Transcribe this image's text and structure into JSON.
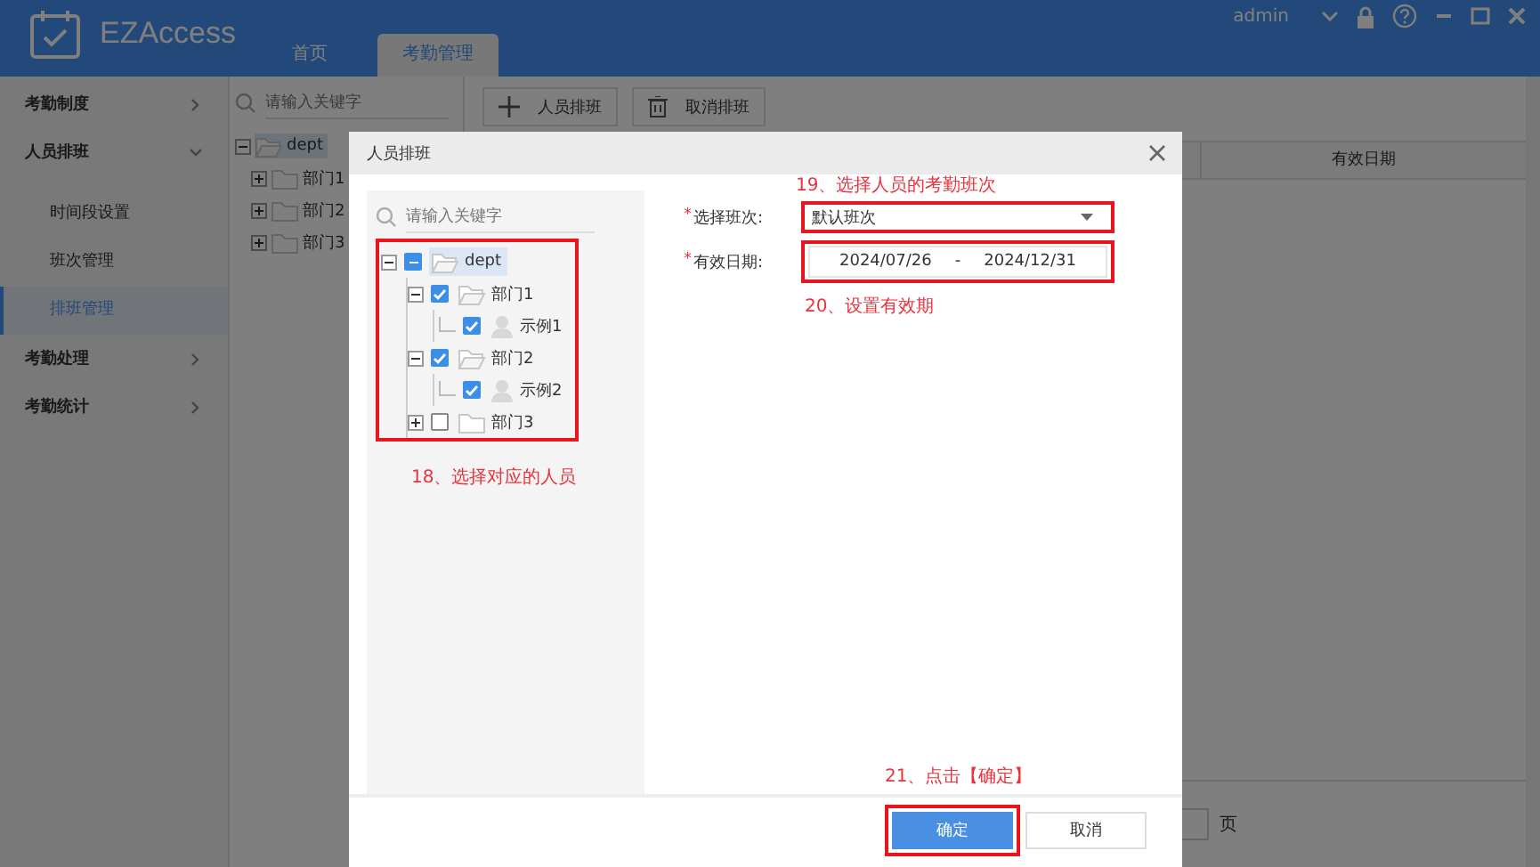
{
  "header": {
    "app_name": "EZAccess",
    "tabs": [
      {
        "label": "首页",
        "selected": false
      },
      {
        "label": "考勤管理",
        "selected": true
      }
    ],
    "user": "admin"
  },
  "sidebar": {
    "items": [
      {
        "label": "考勤制度",
        "expanded": false
      },
      {
        "label": "人员排班",
        "expanded": true,
        "children": [
          {
            "label": "时间段设置",
            "selected": false
          },
          {
            "label": "班次管理",
            "selected": false
          },
          {
            "label": "排班管理",
            "selected": true
          }
        ]
      },
      {
        "label": "考勤处理",
        "expanded": false
      },
      {
        "label": "考勤统计",
        "expanded": false
      }
    ]
  },
  "dept_panel": {
    "search": {
      "placeholder": "请输入关键字"
    },
    "tree": [
      {
        "label": "dept",
        "kind": "folder",
        "expanded": true,
        "selected": true,
        "children": [
          {
            "label": "部门1",
            "kind": "folder",
            "expanded": false,
            "selected": false
          },
          {
            "label": "部门2",
            "kind": "folder",
            "expanded": false,
            "selected": false
          },
          {
            "label": "部门3",
            "kind": "folder",
            "expanded": false,
            "selected": false
          }
        ]
      }
    ]
  },
  "toolbar": {
    "buttons": [
      {
        "label": "人员排班",
        "kind": "add"
      },
      {
        "label": "取消排班",
        "kind": "delete"
      }
    ]
  },
  "table": {
    "columns": [
      "有效日期"
    ]
  },
  "pagination": {
    "suffix": "页"
  },
  "dialog": {
    "title": "人员排班",
    "search": {
      "placeholder": "请输入关键字"
    },
    "tree": [
      {
        "label": "dept",
        "kind": "folder",
        "expanded": true,
        "selected": true,
        "checked": true,
        "indeterminate": true,
        "children": [
          {
            "label": "部门1",
            "kind": "folder",
            "expanded": true,
            "selected": false,
            "checked": true,
            "indeterminate": false,
            "children": [
              {
                "label": "示例1",
                "kind": "person",
                "selected": false,
                "checked": true,
                "indeterminate": false
              }
            ]
          },
          {
            "label": "部门2",
            "kind": "folder",
            "expanded": true,
            "selected": false,
            "checked": true,
            "indeterminate": false,
            "children": [
              {
                "label": "示例2",
                "kind": "person",
                "selected": false,
                "checked": true,
                "indeterminate": false
              }
            ]
          },
          {
            "label": "部门3",
            "kind": "folder",
            "expanded": false,
            "selected": false,
            "checked": false,
            "indeterminate": false
          }
        ]
      }
    ],
    "tree_note": "18、选择对应的人员",
    "fields": [
      {
        "label": "选择班次:",
        "required_mark": "*",
        "kind": "select",
        "value": "默认班次",
        "note_above": "19、选择人员的考勤班次"
      },
      {
        "label": "有效日期:",
        "required_mark": "*",
        "kind": "date_range",
        "start": "2024/07/26",
        "separator": "-",
        "end": "2024/12/31",
        "note_below": "20、设置有效期"
      }
    ],
    "button_note": "21、点击【确定】",
    "buttons": [
      {
        "label": "确定",
        "kind": "primary"
      },
      {
        "label": "取消",
        "kind": "secondary"
      }
    ]
  }
}
